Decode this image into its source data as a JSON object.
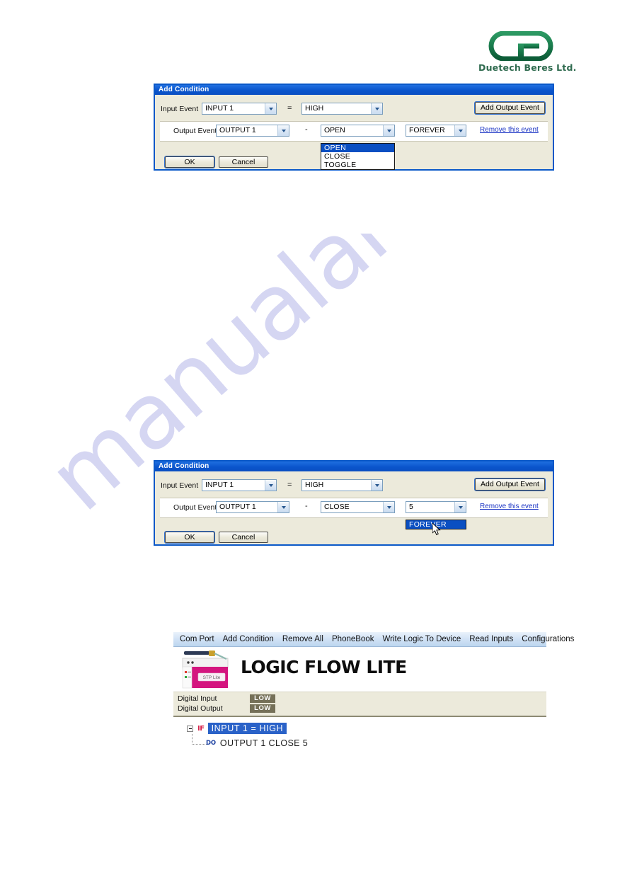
{
  "watermark": {
    "text": "manualarchive.com"
  },
  "logo": {
    "mark": "gb-monogram",
    "company": "Duetech Beres Ltd.",
    "color": "#1c7a4a"
  },
  "dialog_1": {
    "title": "Add Condition",
    "input_row": {
      "label": "Input Event",
      "source_value": "INPUT 1",
      "operator": "=",
      "state_value": "HIGH"
    },
    "output_row": {
      "label": "Output Event",
      "target_value": "OUTPUT 1",
      "separator": "-",
      "action_value": "OPEN",
      "duration_value": "FOREVER",
      "remove_link": "Remove this event"
    },
    "action_dropdown": {
      "open": true,
      "options": [
        "OPEN",
        "CLOSE",
        "TOGGLE"
      ],
      "selected": "OPEN"
    },
    "add_output_button": "Add Output Event",
    "ok_button": "OK",
    "cancel_button": "Cancel"
  },
  "dialog_2": {
    "title": "Add Condition",
    "input_row": {
      "label": "Input Event",
      "source_value": "INPUT 1",
      "operator": "=",
      "state_value": "HIGH"
    },
    "output_row": {
      "label": "Output Event",
      "target_value": "OUTPUT 1",
      "separator": "-",
      "action_value": "CLOSE",
      "duration_value": "5",
      "remove_link": "Remove this event"
    },
    "duration_dropdown": {
      "open": true,
      "options": [
        "FOREVER"
      ],
      "selected": "FOREVER"
    },
    "add_output_button": "Add Output Event",
    "ok_button": "OK",
    "cancel_button": "Cancel"
  },
  "app": {
    "menu": [
      "Com Port",
      "Add Condition",
      "Remove All",
      "PhoneBook",
      "Write Logic To Device",
      "Read Inputs",
      "Configurations"
    ],
    "brand_title": "LOGIC FLOW LITE",
    "device_label": "STP Lite",
    "status": {
      "input_label": "Digital Input",
      "input_value": "LOW",
      "output_label": "Digital Output",
      "output_value": "LOW"
    },
    "tree": {
      "if_keyword": "IF",
      "if_text": "INPUT 1  =  HIGH",
      "do_keyword": "DO",
      "do_text": "OUTPUT 1 CLOSE 5"
    }
  }
}
